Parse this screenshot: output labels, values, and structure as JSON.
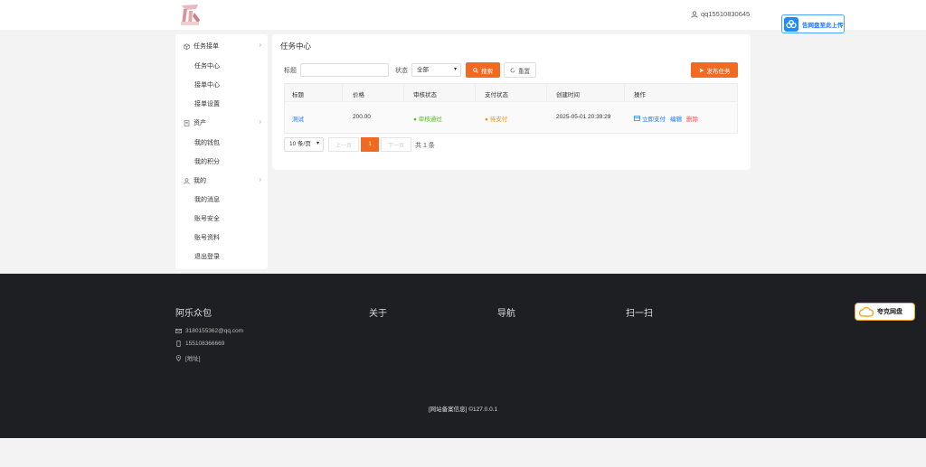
{
  "header": {
    "username": "qq15510830645",
    "baidu_label": "告网盘至此上传",
    "logo_icon": "logo-icon"
  },
  "sidebar": {
    "groups": [
      {
        "label": "任务接单",
        "icon": "box-icon",
        "items": [
          "任务中心",
          "接单中心",
          "接单设置"
        ]
      },
      {
        "label": "资产",
        "icon": "ledger-icon",
        "items": [
          "我的钱包",
          "我的积分"
        ]
      },
      {
        "label": "我的",
        "icon": "user-icon",
        "items": [
          "我的消息",
          "账号安全",
          "账号资料",
          "退出登录"
        ]
      }
    ]
  },
  "main": {
    "title": "任务中心",
    "filters": {
      "title_label": "标题",
      "title_value": "",
      "status_label": "状态",
      "status_value": "全部",
      "search_label": "搜索",
      "reset_label": "重置",
      "publish_label": "发布任务"
    },
    "table": {
      "columns": [
        "标题",
        "价格",
        "审核状态",
        "支付状态",
        "创建时间",
        "操作"
      ],
      "rows": [
        {
          "title": "测试",
          "price": "200.00",
          "review_status": "审核通过",
          "pay_status": "待支付",
          "created": "2025-05-01 20:39:29",
          "actions": [
            "立即支付",
            "编辑",
            "删除"
          ]
        }
      ]
    },
    "pagination": {
      "page_size": "10 条/页",
      "prev": "上一页",
      "current": "1",
      "next": "下一页",
      "total": "共 1 条"
    }
  },
  "footer": {
    "brand": "阿乐众包",
    "about": "关于",
    "nav": "导航",
    "scan": "扫一扫",
    "email": "3180155362@qq.com",
    "phone": "155108366669",
    "address": "[地址]",
    "copyright": "[网站备案信息] ©127.0.0.1",
    "quark_label": "夸克网盘"
  },
  "colors": {
    "accent": "#f26a21",
    "link": "#1677ff",
    "success": "#52c41a",
    "warning": "#fa8c16",
    "danger": "#ff4d4f",
    "footer_bg": "#1e1f22"
  }
}
